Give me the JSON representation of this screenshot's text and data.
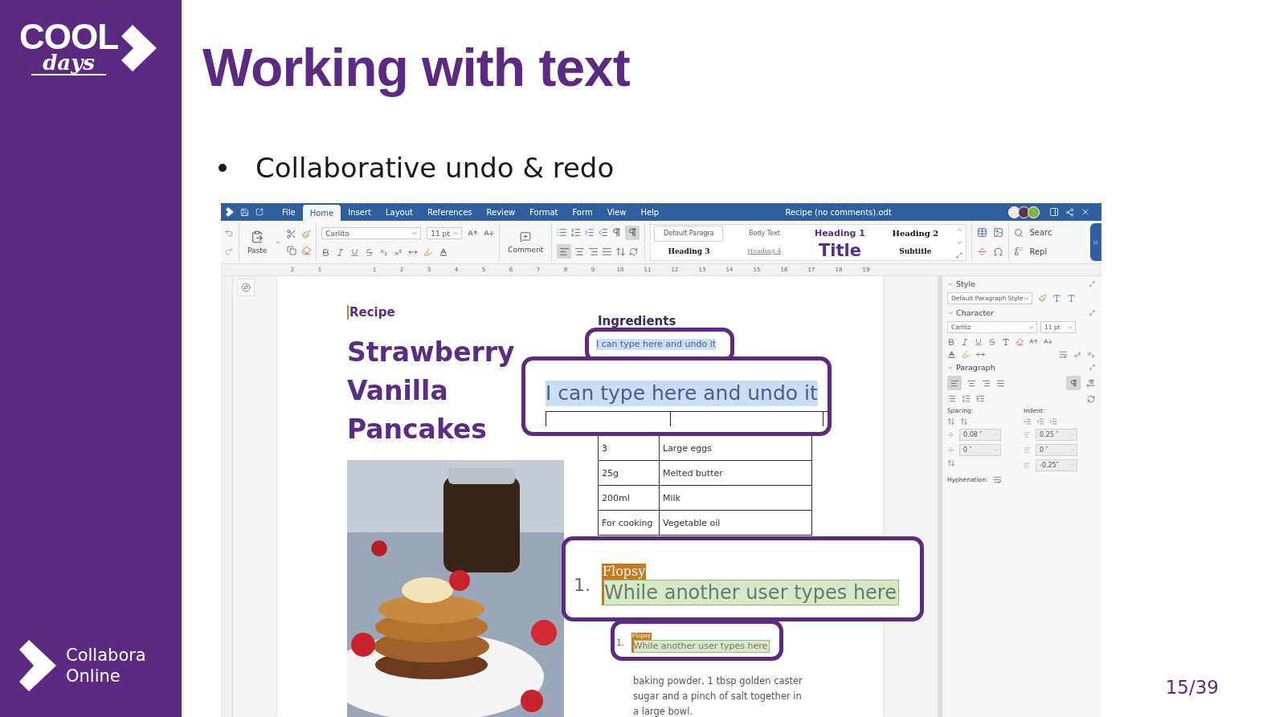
{
  "slide": {
    "title": "Working with text",
    "bullet": "Collaborative undo & redo",
    "page_number": "15/39"
  },
  "logos": {
    "event_top": "COOL",
    "event_bottom": "days",
    "company_line1": "Collabora",
    "company_line2": "Online"
  },
  "app": {
    "document_title": "Recipe (no comments).odt",
    "menu": [
      {
        "label": "File",
        "selected": false
      },
      {
        "label": "Home",
        "selected": true
      },
      {
        "label": "Insert",
        "selected": false
      },
      {
        "label": "Layout",
        "selected": false
      },
      {
        "label": "References",
        "selected": false
      },
      {
        "label": "Review",
        "selected": false
      },
      {
        "label": "Format",
        "selected": false
      },
      {
        "label": "Form",
        "selected": false
      },
      {
        "label": "View",
        "selected": false
      },
      {
        "label": "Help",
        "selected": false
      }
    ],
    "users": [
      {
        "color": "#eeeae4"
      },
      {
        "color": "#5a3550"
      },
      {
        "color": "#7cb342"
      }
    ],
    "toolbar": {
      "paste": "Paste",
      "font": "Carlito",
      "size": "11 pt",
      "comment": "Comment",
      "formatting_marks": {
        "on": true
      },
      "align_left": {
        "on": true
      },
      "styles": [
        {
          "label": "Default Paragra",
          "kind": "default",
          "selected": true
        },
        {
          "label": "Body Text",
          "kind": "body",
          "selected": false
        },
        {
          "label": "Heading 1",
          "kind": "h1",
          "selected": false
        },
        {
          "label": "Heading 2",
          "kind": "h2",
          "selected": false
        },
        {
          "label": "Heading 3",
          "kind": "h3",
          "selected": false
        },
        {
          "label": "Heading 4",
          "kind": "h4",
          "selected": false
        },
        {
          "label": "Title",
          "kind": "title",
          "selected": false
        },
        {
          "label": "Subtitle",
          "kind": "subtitle",
          "selected": false
        }
      ],
      "search": "Searc",
      "replace": "Repl"
    },
    "ruler": {
      "before": [
        "2",
        "1"
      ],
      "after": [
        "1",
        "2",
        "3",
        "4",
        "5",
        "6",
        "7",
        "8",
        "9",
        "10",
        "11",
        "12",
        "13",
        "14",
        "15",
        "16",
        "17",
        "18",
        "19"
      ]
    },
    "document": {
      "label": "Recipe",
      "title_lines": [
        "Strawberry",
        "Vanilla",
        "Pancakes"
      ],
      "ingredients_heading": "Ingredients",
      "ingredients": [
        {
          "amount": "3",
          "item": "Large eggs"
        },
        {
          "amount": "25g",
          "item": "Melted butter"
        },
        {
          "amount": "200ml",
          "item": "Milk"
        },
        {
          "amount": "For cooking",
          "item": "Vegetable oil"
        }
      ],
      "step_text": "baking powder, 1 tbsp golden caster sugar and a pinch of salt together in a large bowl."
    },
    "callouts": [
      {
        "kind": "undo",
        "text": "I can type here and undo it"
      },
      {
        "kind": "undo-zoom",
        "text": "I can type here and undo it"
      },
      {
        "kind": "typing-zoom",
        "author": "Flopsy",
        "number": "1.",
        "text": "While another user types here"
      },
      {
        "kind": "typing",
        "author": "Flopsy",
        "number": "1.",
        "text": "While another user types here"
      }
    ],
    "sidebar": {
      "style_title": "Style",
      "paragraph_style": "Default Paragraph Style",
      "character_title": "Character",
      "font": "Carlito",
      "size": "11 pt",
      "paragraph_title": "Paragraph",
      "align_left": {
        "on": true
      },
      "ltr": {
        "on": true
      },
      "spacing_label": "Spacing:",
      "indent_label": "Indent:",
      "spacing_values": [
        "0.08 ″",
        "0 ″"
      ],
      "indent_values": [
        "0.25 ″",
        "0 ″",
        "-0.25″"
      ],
      "hyphenation_label": "Hyphenation:"
    }
  }
}
